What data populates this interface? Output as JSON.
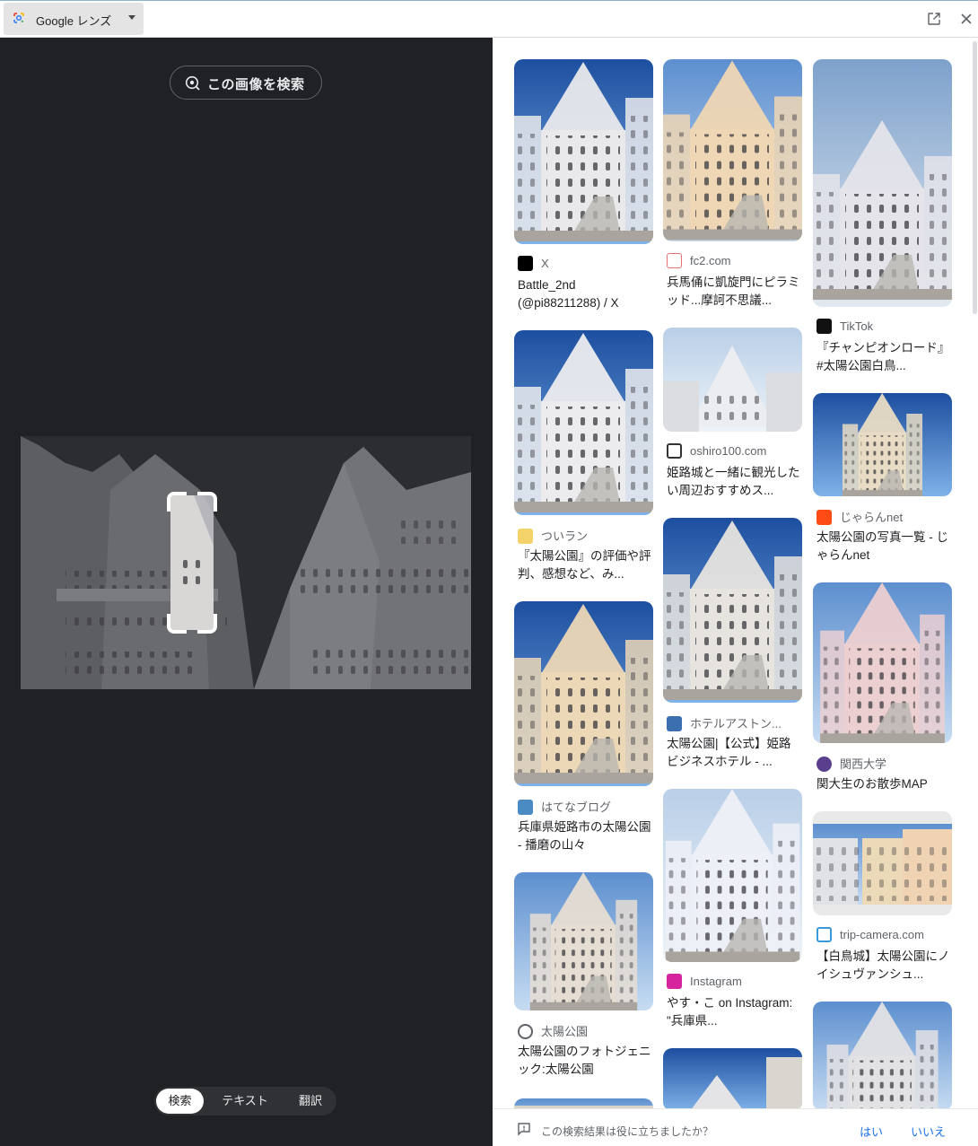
{
  "topbar": {
    "title": "Google レンズ",
    "icons": [
      "google-lens-logo-icon",
      "open-in-new-icon",
      "close-icon"
    ]
  },
  "left": {
    "search_image_label": "この画像を検索",
    "modes": [
      "検索",
      "テキスト",
      "翻訳"
    ],
    "active_mode": "検索"
  },
  "results": [
    {
      "source": "X",
      "title": "Battle_2nd (@pi88211288) / X",
      "favicon": "x-icon"
    },
    {
      "source": "fc2.com",
      "title": "兵馬俑に凱旋門にピラミッド...摩訶不思議...",
      "favicon": "fc2-icon"
    },
    {
      "source": "TikTok",
      "title": "『チャンピオンロード』 #太陽公園白鳥...",
      "favicon": "tiktok-icon"
    },
    {
      "source": "ついラン",
      "title": "『太陽公園』の評価や評判、感想など、み...",
      "favicon": "tsuiran-icon"
    },
    {
      "source": "oshiro100.com",
      "title": "姫路城と一緒に観光したい周辺おすすめス...",
      "favicon": "castle-icon"
    },
    {
      "source": "じゃらんnet",
      "title": "太陽公園の写真一覧 - じゃらんnet",
      "favicon": "jalan-icon"
    },
    {
      "source": "はてなブログ",
      "title": "兵庫県姫路市の太陽公園 - 播磨の山々",
      "favicon": "hatena-icon"
    },
    {
      "source": "ホテルアストン...",
      "title": "太陽公園|【公式】姫路ビジネスホテル - ...",
      "favicon": "hotel-icon"
    },
    {
      "source": "関西大学",
      "title": "関大生のお散歩MAP",
      "favicon": "kansai-univ-icon"
    },
    {
      "source": "太陽公園",
      "title": "太陽公園のフォトジェニック:太陽公園",
      "favicon": "globe-icon"
    },
    {
      "source": "Instagram",
      "title": "やす・こ on Instagram: \"兵庫県...",
      "favicon": "instagram-icon"
    },
    {
      "source": "trip-camera.com",
      "title": "【白鳥城】太陽公園にノイシュヴァンシュ...",
      "favicon": "trip-camera-icon"
    }
  ],
  "feedback": {
    "question": "この検索結果は役に立ちましたか？",
    "yes": "はい",
    "no": "いいえ"
  },
  "colors": {
    "left_bg": "#202124",
    "link": "#1a73e8",
    "chip_bg": "#303134"
  }
}
